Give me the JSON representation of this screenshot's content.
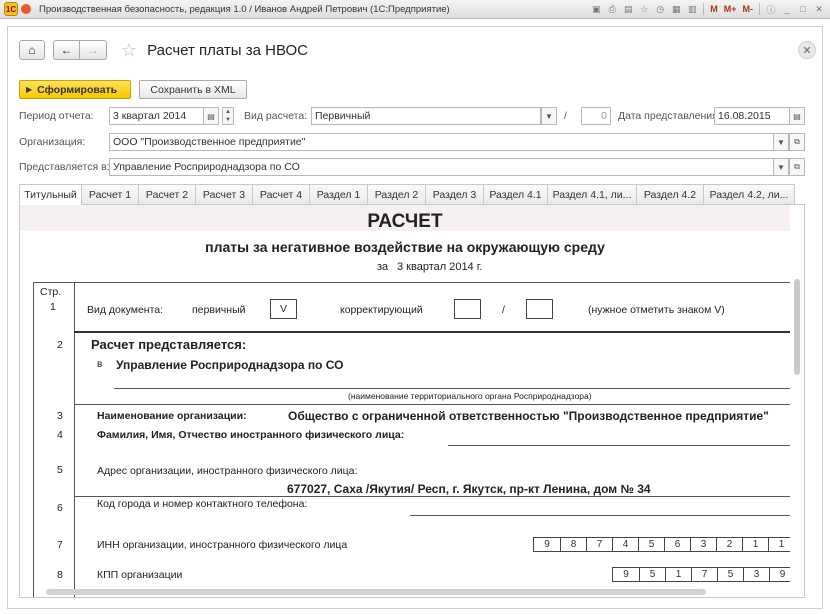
{
  "window": {
    "title": "Производственная безопасность, редакция 1.0 / Иванов Андрей Петрович (1С:Предприятие)",
    "logo_text": "1С",
    "tools": [
      "M",
      "M+",
      "M-"
    ]
  },
  "header": {
    "title": "Расчет платы за НВОС"
  },
  "commands": {
    "generate": "Сформировать",
    "save_xml": "Сохранить в XML"
  },
  "form": {
    "period_label": "Период отчета:",
    "period_value": "3 квартал 2014",
    "calc_type_label": "Вид расчета:",
    "calc_type_value": "Первичный",
    "slash": "/",
    "correction_number": "0",
    "submission_date_label": "Дата представления:",
    "submission_date_value": "16.08.2015",
    "organization_label": "Организация:",
    "organization_value": "ООО \"Производственное предприятие\"",
    "submitted_to_label": "Представляется в:",
    "submitted_to_value": "Управление Росприроднадзора по СО"
  },
  "tabs": [
    {
      "label": "Титульный",
      "active": true
    },
    {
      "label": "Расчет 1"
    },
    {
      "label": "Расчет 2"
    },
    {
      "label": "Расчет 3"
    },
    {
      "label": "Расчет 4"
    },
    {
      "label": "Раздел 1"
    },
    {
      "label": "Раздел 2"
    },
    {
      "label": "Раздел 3"
    },
    {
      "label": "Раздел 4.1"
    },
    {
      "label": "Раздел 4.1, ли..."
    },
    {
      "label": "Раздел 4.2"
    },
    {
      "label": "Раздел 4.2, ли..."
    }
  ],
  "document": {
    "title": "РАСЧЕТ",
    "subtitle": "платы за негативное воздействие на окружающую среду",
    "period_prefix": "за",
    "period": "3 квартал 2014 г.",
    "row_col_header": "Стр.",
    "rows": {
      "r1": {
        "num": "1",
        "label": "Вид документа:",
        "primary": "первичный",
        "primary_mark": "V",
        "corrective": "корректирующий",
        "slash": "/",
        "hint": "(нужное отметить знаком V)"
      },
      "r2": {
        "num": "2",
        "label": "Расчет представляется:",
        "prefix": "в",
        "value": "Управление Росприроднадзора по СО",
        "caption": "(наименование территориального органа Росприроднадзора)"
      },
      "r3": {
        "num": "3",
        "label": "Наименование организации:",
        "value": "Общество с ограниченной ответственностью \"Производственное предприятие\""
      },
      "r4": {
        "num": "4",
        "label": "Фамилия, Имя, Отчество иностранного физического лица:"
      },
      "r5": {
        "num": "5",
        "label": "Адрес организации, иностранного физического лица:",
        "value": "677027, Саха /Якутия/ Респ, г. Якутск, пр-кт Ленина, дом № 34"
      },
      "r6": {
        "num": "6",
        "label": "Код города и номер контактного телефона:"
      },
      "r7": {
        "num": "7",
        "label": "ИНН организации, иностранного физического лица",
        "digits": [
          "9",
          "8",
          "7",
          "4",
          "5",
          "6",
          "3",
          "2",
          "1",
          "1"
        ]
      },
      "r8": {
        "num": "8",
        "label": "КПП организации",
        "digits": [
          "9",
          "5",
          "1",
          "7",
          "5",
          "3",
          "9"
        ]
      }
    }
  }
}
